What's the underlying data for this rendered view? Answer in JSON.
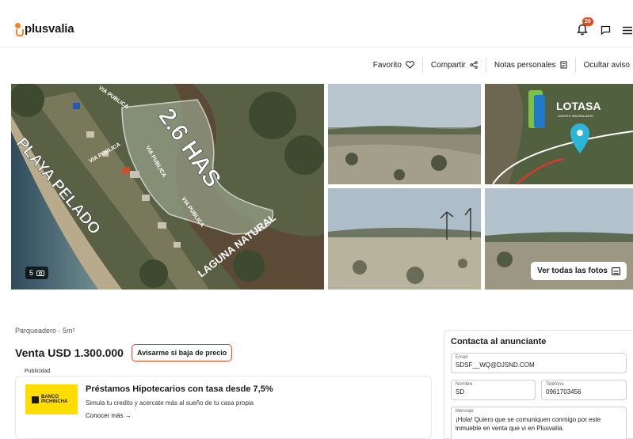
{
  "header": {
    "logo_text": "plusvalia",
    "notifications_count": "20",
    "icons": [
      "bell-icon",
      "flag-icon",
      "menu-icon"
    ]
  },
  "actions": {
    "favorite": "Favorito",
    "share": "Compartir",
    "notes": "Notas personales",
    "hide": "Ocultar aviso"
  },
  "gallery": {
    "main_photo_overlay": {
      "area": "2.6 HAS",
      "beach": "PLAYA PELADO",
      "lagoon": "LAGUNA NATURAL",
      "roads": [
        "VIA PUBLICA",
        "VIA PUBLICA",
        "VIA PUBLICA",
        "VIA PUBLICA"
      ]
    },
    "thumb_logo": "LOTASA",
    "thumb_logo_sub": "AGENTE INMOBILIARIO",
    "photo_count": "5",
    "see_all_label": "Ver todas las fotos"
  },
  "listing": {
    "features": "Parqueadero · 5m²",
    "price": "Venta USD 1.300.000",
    "price_alert_button": "Avisarme si baja de precio"
  },
  "ad": {
    "tag": "Publicidad",
    "bank_name_line1": "BANCO",
    "bank_name_line2": "PICHINCHA",
    "title": "Préstamos Hipotecarios con tasa desde 7,5%",
    "description": "Simula tu credito y acercate más al sueño de tu casa propia",
    "link": "Conocer más →"
  },
  "contact": {
    "title": "Contacta al anunciante",
    "email_label": "Email",
    "email_value": "SDSF__WQ@DJSND.COM",
    "name_label": "Nombre",
    "name_value": "SD",
    "phone_label": "Teléfono",
    "phone_value": "0961703456",
    "message_label": "Mensaje",
    "message_value": "¡Hola! Quiero que se comuniquen conmigo por este inmueble en venta que vi en Plusvalía."
  },
  "colors": {
    "brand": "#f58220",
    "accent": "#e8451b",
    "bank_yellow": "#ffdd00"
  }
}
